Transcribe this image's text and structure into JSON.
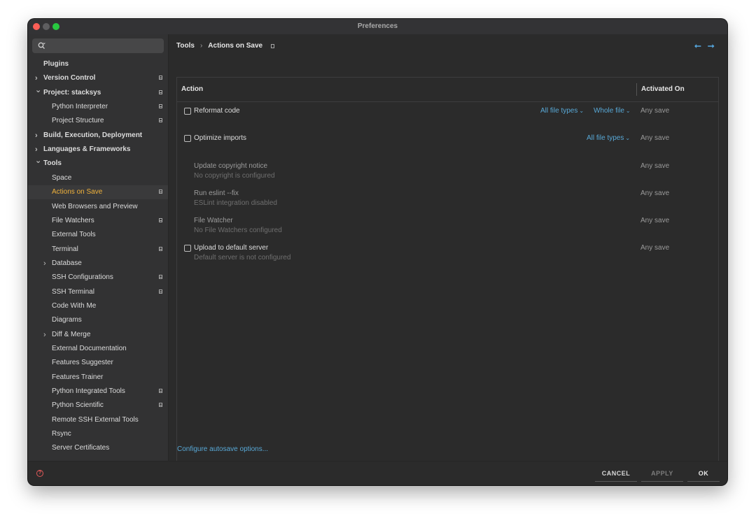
{
  "window": {
    "title": "Preferences"
  },
  "search": {
    "placeholder": ""
  },
  "sidebar": {
    "items": [
      {
        "label": "Plugins",
        "bold": true
      },
      {
        "label": "Version Control",
        "bold": true,
        "arrow": "›",
        "icon": true
      },
      {
        "label": "Project: stacksys",
        "bold": true,
        "arrow": "⌄",
        "icon": true
      },
      {
        "label": "Python Interpreter",
        "icon": true
      },
      {
        "label": "Project Structure",
        "icon": true
      },
      {
        "label": "Build, Execution, Deployment",
        "bold": true,
        "arrow": "›"
      },
      {
        "label": "Languages & Frameworks",
        "bold": true,
        "arrow": "›"
      },
      {
        "label": "Tools",
        "bold": true,
        "arrow": "⌄"
      },
      {
        "label": "Space"
      },
      {
        "label": "Actions on Save",
        "selected": true,
        "icon": true
      },
      {
        "label": "Web Browsers and Preview"
      },
      {
        "label": "File Watchers",
        "icon": true
      },
      {
        "label": "External Tools"
      },
      {
        "label": "Terminal",
        "icon": true
      },
      {
        "label": "Database",
        "arrow": "›"
      },
      {
        "label": "SSH Configurations",
        "icon": true
      },
      {
        "label": "SSH Terminal",
        "icon": true
      },
      {
        "label": "Code With Me"
      },
      {
        "label": "Diagrams"
      },
      {
        "label": "Diff & Merge",
        "arrow": "›"
      },
      {
        "label": "External Documentation"
      },
      {
        "label": "Features Suggester"
      },
      {
        "label": "Features Trainer"
      },
      {
        "label": "Python Integrated Tools",
        "icon": true
      },
      {
        "label": "Python Scientific",
        "icon": true
      },
      {
        "label": "Remote SSH External Tools"
      },
      {
        "label": "Rsync"
      },
      {
        "label": "Server Certificates"
      }
    ]
  },
  "breadcrumb": {
    "parent": "Tools",
    "separator": "›",
    "current": "Actions on Save"
  },
  "nav": {
    "back": "⭠",
    "forward": "⭢"
  },
  "table": {
    "headers": {
      "action": "Action",
      "activated_on": "Activated On"
    },
    "rows": [
      {
        "title": "Reformat code",
        "checkbox": true,
        "file_types": "All file types",
        "scope": "Whole file",
        "activated": "Any save"
      },
      {
        "title": "Optimize imports",
        "checkbox": true,
        "file_types": "All file types",
        "activated": "Any save"
      },
      {
        "title": "Update copyright notice",
        "subtitle": "No copyright is configured",
        "activated": "Any save"
      },
      {
        "title": "Run eslint --fix",
        "subtitle": "ESLint integration disabled",
        "activated": "Any save"
      },
      {
        "title": "File Watcher",
        "subtitle": "No File Watchers configured",
        "activated": "Any save"
      },
      {
        "title": "Upload to default server",
        "checkbox": true,
        "subtitle": "Default server is not configured",
        "activated": "Any save"
      }
    ]
  },
  "autosave_link": "Configure autosave options...",
  "footer": {
    "help": "?",
    "cancel": "CANCEL",
    "apply": "APPLY",
    "ok": "OK"
  }
}
